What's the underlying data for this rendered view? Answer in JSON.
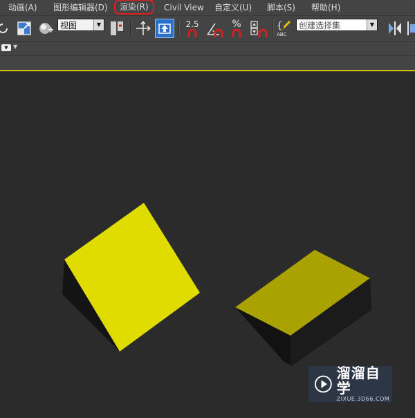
{
  "menubar": {
    "items": [
      {
        "label": "动画(A)"
      },
      {
        "label": "图形编辑器(D)"
      },
      {
        "label": "渲染(R)"
      },
      {
        "label": "Civil View"
      },
      {
        "label": "自定义(U)"
      },
      {
        "label": "脚本(S)"
      },
      {
        "label": "帮助(H)"
      }
    ],
    "highlighted_item": "渲染(R)",
    "highlight_color": "#e02020"
  },
  "toolbar": {
    "view_dropdown": {
      "value": "视图"
    },
    "snap_label": "2.5",
    "percent_snap_label": "%",
    "named_selection": {
      "value": "创建选择集"
    },
    "active_tool_color": "#2a6fc9"
  },
  "viewport": {
    "background": "#2b2b2b",
    "object_color": "#e0dc00"
  },
  "watermark": {
    "brand": "溜溜自学",
    "domain": "ZIXUE.3D66.COM"
  }
}
